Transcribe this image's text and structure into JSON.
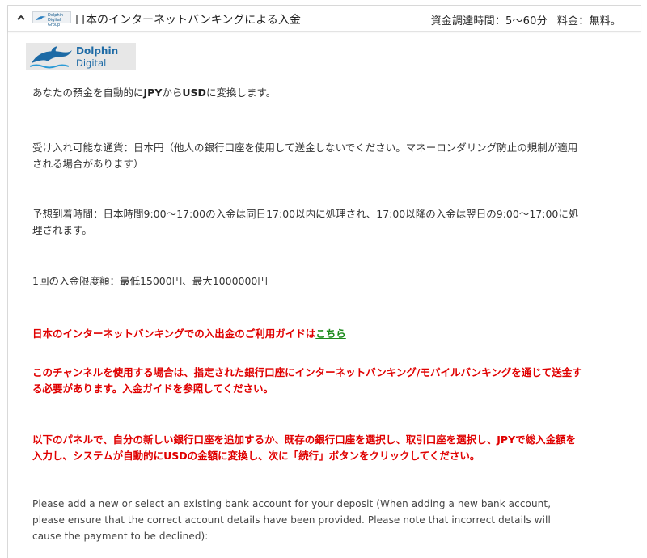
{
  "header": {
    "title": "日本のインターネットバンキングによる入金",
    "processing_time": "資金調達時間：5～60分",
    "fee": "料金：無料。",
    "mini_logo_text_1": "Dolphin",
    "mini_logo_text_2": "Digital Group"
  },
  "logo": {
    "line1": "Dolphin",
    "line2": "Digital Group",
    "color": "#1d6aa5"
  },
  "content": {
    "conversion_prefix": "あなたの預金を自動的に",
    "conversion_from": "JPY",
    "conversion_mid": "から",
    "conversion_to": "USD",
    "conversion_suffix": "に変換します。",
    "currency": "受け入れ可能な通貨：日本円（他人の銀行口座を使用して送金しないでください。マネーロンダリング防止の規制が適用される場合があります）",
    "arrival": "予想到着時間：日本時間9:00～17:00の入金は同日17:00以内に処理され、17:00以降の入金は翌日の9:00～17:00に処理されます。",
    "limit": "1回の入金限度額：最低15000円、最大1000000円",
    "guide_text": "日本のインターネットバンキングでの入出金のご利用ガイドは",
    "guide_link": "こちら",
    "channel_notice": "このチャンネルを使用する場合は、指定された銀行口座にインターネットバンキング/モバイルバンキングを通じて送金する必要があります。入金ガイドを参照してください。",
    "panel_notice": "以下のパネルで、自分の新しい銀行口座を追加するか、既存の銀行口座を選択し、取引口座を選択し、JPYで総入金額を入力し、システムが自動的にUSDの金額に変換し、次に「続行」ボタンをクリックしてください。",
    "english_notice": "Please add a new or select an existing bank account for your deposit (When adding a new bank account, please ensure that the correct account details have been provided. Please note that incorrect details will cause the payment to be declined):"
  },
  "colors": {
    "alert": "#e00000",
    "link": "#1a8a1a"
  },
  "icons": {
    "collapse": "chevron-up-icon",
    "brand": "dolphin-logo-icon"
  }
}
